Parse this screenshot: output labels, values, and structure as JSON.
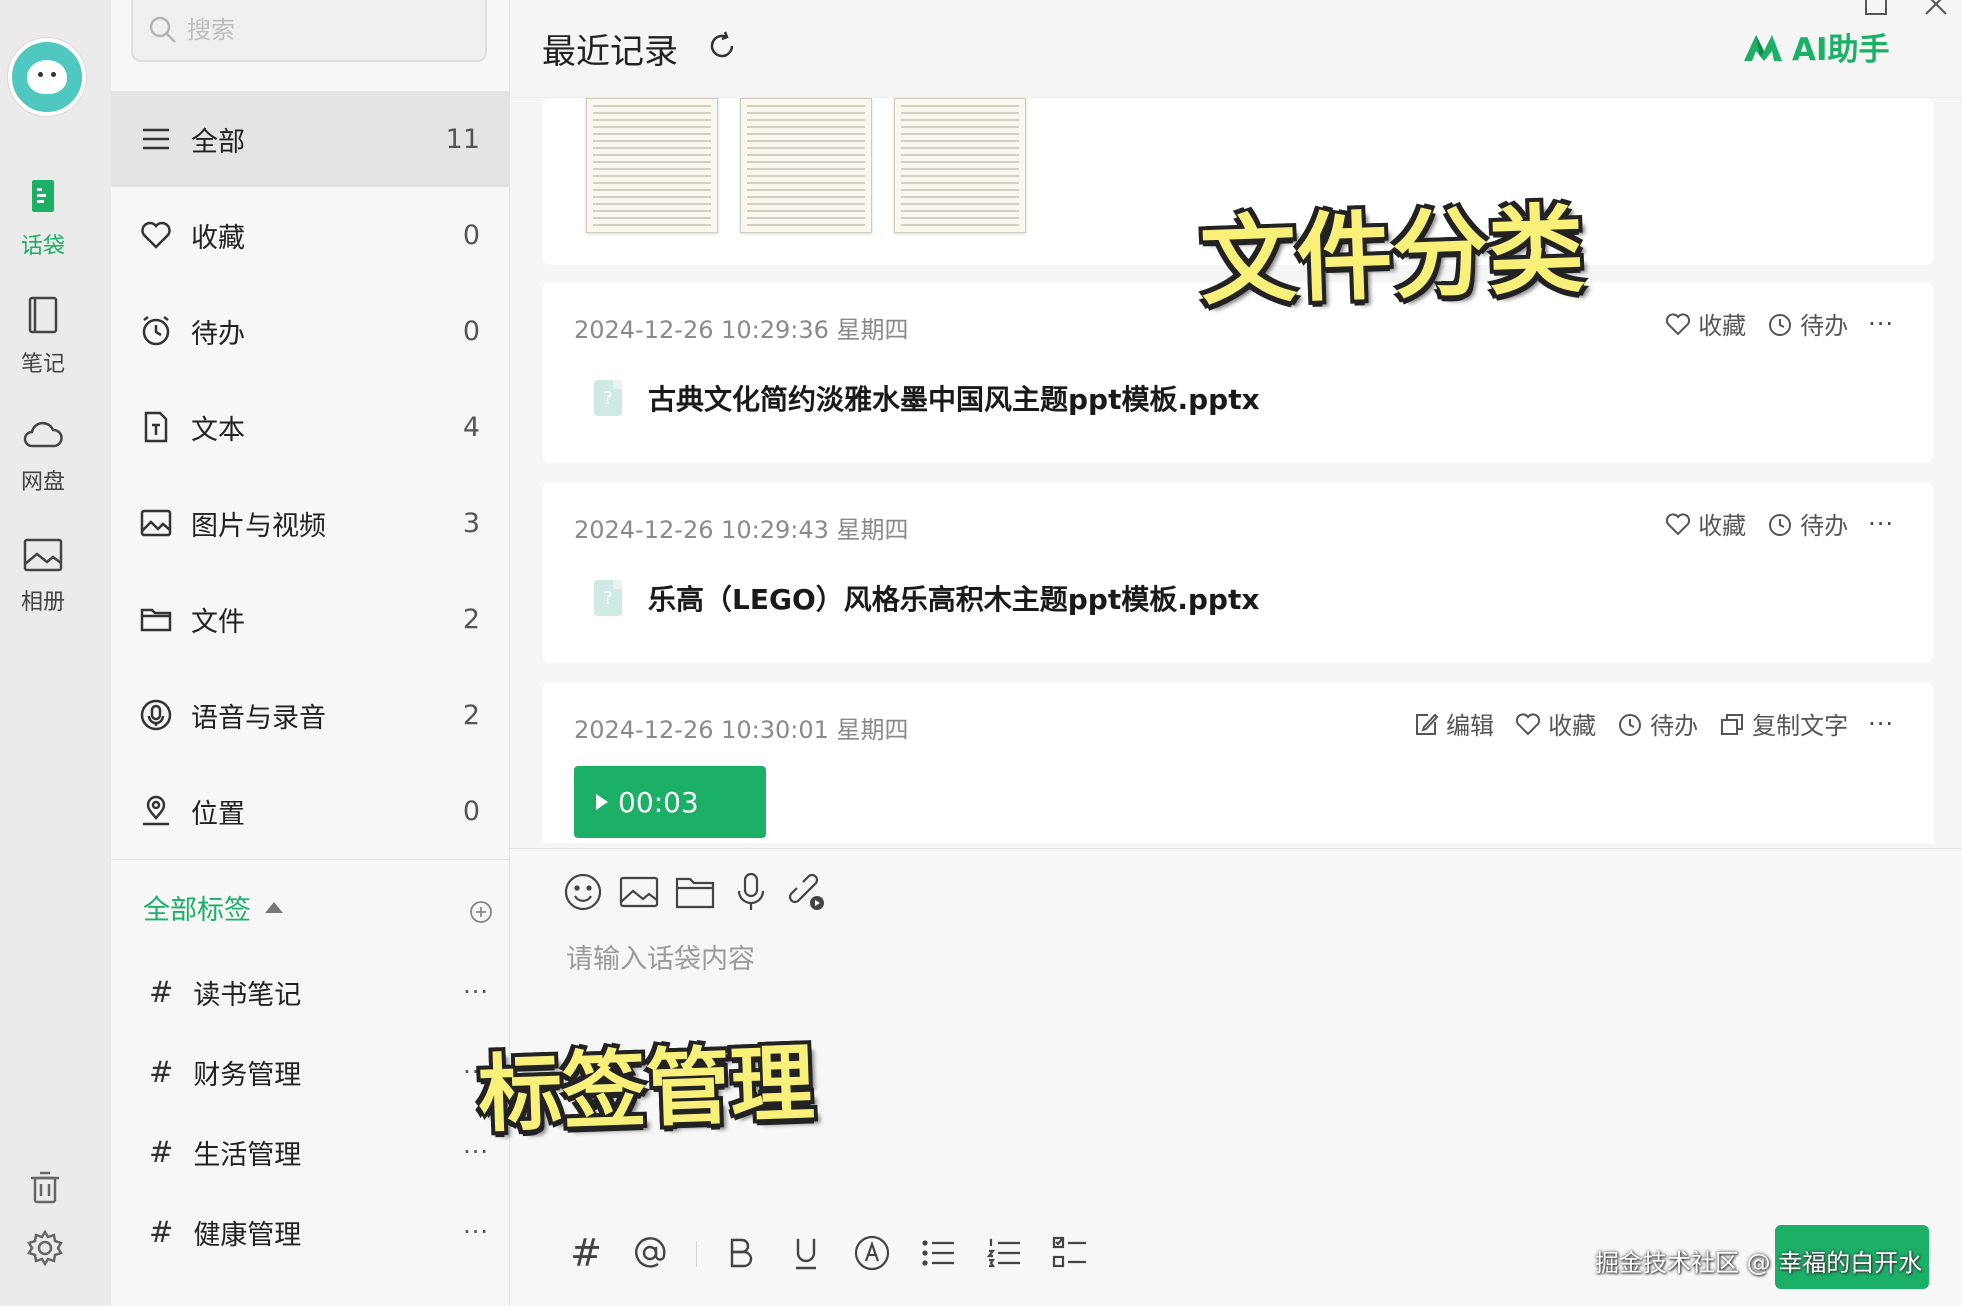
{
  "rail": {
    "items": [
      {
        "label": "话袋",
        "icon": "chat-bag-icon",
        "active": true
      },
      {
        "label": "笔记",
        "icon": "notebook-icon",
        "active": false
      },
      {
        "label": "网盘",
        "icon": "cloud-icon",
        "active": false
      },
      {
        "label": "相册",
        "icon": "photo-icon",
        "active": false
      }
    ],
    "bottom": [
      {
        "icon": "trash-icon"
      },
      {
        "icon": "gear-icon"
      }
    ]
  },
  "panel": {
    "search_placeholder": "搜索",
    "categories": [
      {
        "label": "全部",
        "count": "11",
        "icon": "menu-icon",
        "active": true
      },
      {
        "label": "收藏",
        "count": "0",
        "icon": "heart-icon"
      },
      {
        "label": "待办",
        "count": "0",
        "icon": "alarm-icon"
      },
      {
        "label": "文本",
        "count": "4",
        "icon": "text-doc-icon"
      },
      {
        "label": "图片与视频",
        "count": "3",
        "icon": "image-icon"
      },
      {
        "label": "文件",
        "count": "2",
        "icon": "folder-icon"
      },
      {
        "label": "语音与录音",
        "count": "2",
        "icon": "voice-icon"
      },
      {
        "label": "位置",
        "count": "0",
        "icon": "location-icon"
      }
    ],
    "tags_header": "全部标签",
    "tags": [
      {
        "hash": "#",
        "label": "读书笔记",
        "more": "···"
      },
      {
        "hash": "#",
        "label": "财务管理",
        "more": "···"
      },
      {
        "hash": "#",
        "label": "生活管理",
        "more": "···"
      },
      {
        "hash": "#",
        "label": "健康管理",
        "more": "···"
      }
    ]
  },
  "header": {
    "title": "最近记录",
    "ai_label": "AI助手"
  },
  "messages": [
    {
      "time": "2024-12-26 10:29:36 星期四",
      "file": "古典文化简约淡雅水墨中国风主题ppt模板.pptx",
      "file_icon": "?",
      "actions": {
        "favorite": "收藏",
        "todo": "待办",
        "more": "···"
      }
    },
    {
      "time": "2024-12-26 10:29:43 星期四",
      "file": "乐高（LEGO）风格乐高积木主题ppt模板.pptx",
      "file_icon": "?",
      "actions": {
        "favorite": "收藏",
        "todo": "待办",
        "more": "···"
      }
    },
    {
      "time": "2024-12-26 10:30:01 星期四",
      "audio_duration": "00:03",
      "actions": {
        "edit": "编辑",
        "favorite": "收藏",
        "todo": "待办",
        "copy": "复制文字",
        "more": "···"
      }
    }
  ],
  "composer": {
    "placeholder": "请输入话袋内容",
    "tools": [
      "emoji-icon",
      "image-icon",
      "folder-icon",
      "mic-icon",
      "link-icon"
    ],
    "format_hash": "#"
  },
  "overlays": {
    "file_caption": "文件分类",
    "tag_caption": "标签管理",
    "watermark": "掘金技术社区 @ 幸福的白开水"
  },
  "colors": {
    "accent": "#1bb066",
    "caption_fill": "#f9f07a"
  }
}
